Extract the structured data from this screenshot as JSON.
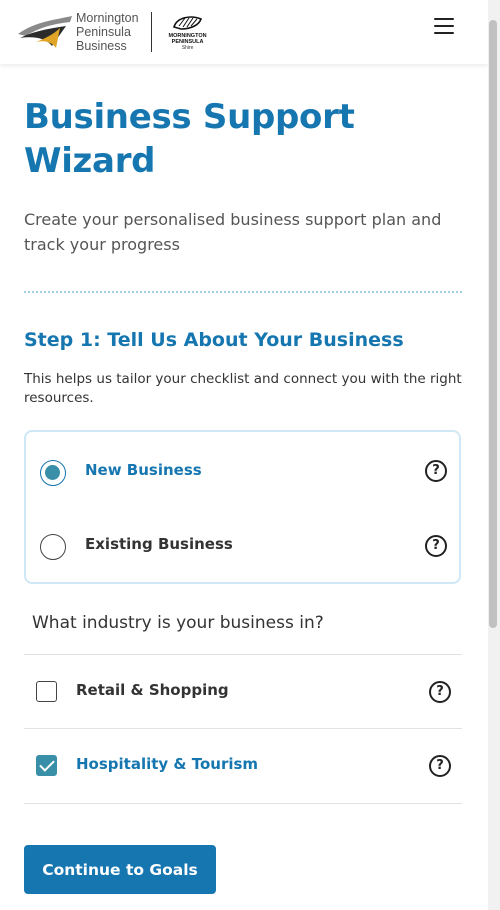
{
  "brand": {
    "line1": "Mornington",
    "line2": "Peninsula",
    "line3": "Business",
    "shire_line1": "MORNINGTON",
    "shire_line2": "PENINSULA",
    "shire_sub": "Shire"
  },
  "page": {
    "title": "Business Support Wizard",
    "subtitle": "Create your personalised business support plan and track your progress"
  },
  "step": {
    "title": "Step 1: Tell Us About Your Business",
    "description": "This helps us tailor your checklist and connect you with the right resources."
  },
  "business_type": {
    "options": [
      {
        "label": "New Business",
        "selected": true
      },
      {
        "label": "Existing Business",
        "selected": false
      }
    ]
  },
  "industry": {
    "question": "What industry is your business in?",
    "options": [
      {
        "label": "Retail & Shopping",
        "checked": false
      },
      {
        "label": "Hospitality & Tourism",
        "checked": true
      }
    ]
  },
  "help_icon_glyph": "?",
  "actions": {
    "continue_label": "Continue to Goals"
  },
  "colors": {
    "accent": "#1576b0",
    "checked": "#3a8fa8"
  },
  "icons": [
    "logo-swoosh-icon",
    "shire-shell-icon",
    "hamburger-menu-icon",
    "help-circle-icon",
    "checkmark-icon"
  ]
}
